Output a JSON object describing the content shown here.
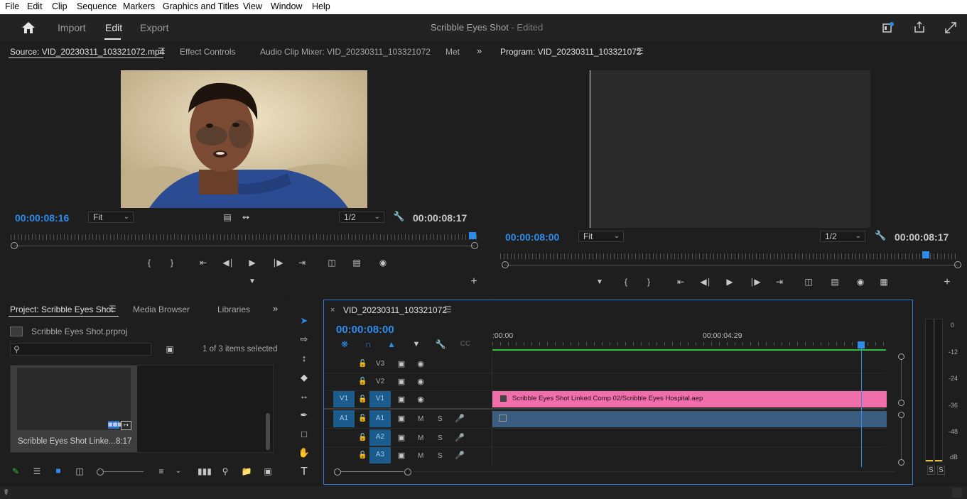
{
  "menu": [
    "File",
    "Edit",
    "Clip",
    "Sequence",
    "Markers",
    "Graphics and Titles",
    "View",
    "Window",
    "Help"
  ],
  "header": {
    "tabs": [
      "Import",
      "Edit",
      "Export"
    ],
    "active_tab": "Edit",
    "project_title": "Scribble Eyes Shot",
    "status": " - Edited"
  },
  "source": {
    "tab_label": "Source: VID_20230311_103321072.mp4",
    "effect_controls": "Effect Controls",
    "audio_mixer": "Audio Clip Mixer: VID_20230311_103321072",
    "met": "Met",
    "timecode": "00:00:08:16",
    "fit": "Fit",
    "resolution": "1/2",
    "duration": "00:00:08:17"
  },
  "program": {
    "tab_label": "Program: VID_20230311_103321072",
    "timecode": "00:00:08:00",
    "fit": "Fit",
    "resolution": "1/2",
    "duration": "00:00:08:17"
  },
  "project": {
    "tab_label": "Project: Scribble Eyes Shot",
    "media_browser": "Media Browser",
    "libraries": "Libraries",
    "file_name": "Scribble Eyes Shot.prproj",
    "items_selected": "1 of 3 items selected",
    "search_placeholder": "",
    "clip_name": "Scribble Eyes Shot Linke...",
    "clip_duration": "8:17"
  },
  "timeline": {
    "tab_label": "VID_20230311_103321072",
    "timecode": "00:00:08:00",
    "ruler_start": ":00:00",
    "ruler_mid": "00:00:04:29",
    "video_tracks": [
      "V3",
      "V2",
      "V1"
    ],
    "audio_tracks": [
      "A1",
      "A2",
      "A3"
    ],
    "src_v": "V1",
    "src_a": "A1",
    "mute": "M",
    "solo": "S",
    "clip_v1": "Scribble Eyes Shot Linked Comp 02/Scribble Eyes Hospital.aep"
  },
  "meter": {
    "scale": [
      "0",
      "-12",
      "-24",
      "-36",
      "-48",
      "dB"
    ],
    "solo_left": "S",
    "solo_right": "S"
  },
  "colors": {
    "accent_blue": "#2d8ceb",
    "clip_pink": "#f06ea9",
    "audio_clip": "#3b5d80",
    "work_area_green": "#2fbf3f"
  },
  "icons": {
    "home": "home-icon",
    "playhead": "playhead-icon",
    "settings": "wrench-icon"
  }
}
